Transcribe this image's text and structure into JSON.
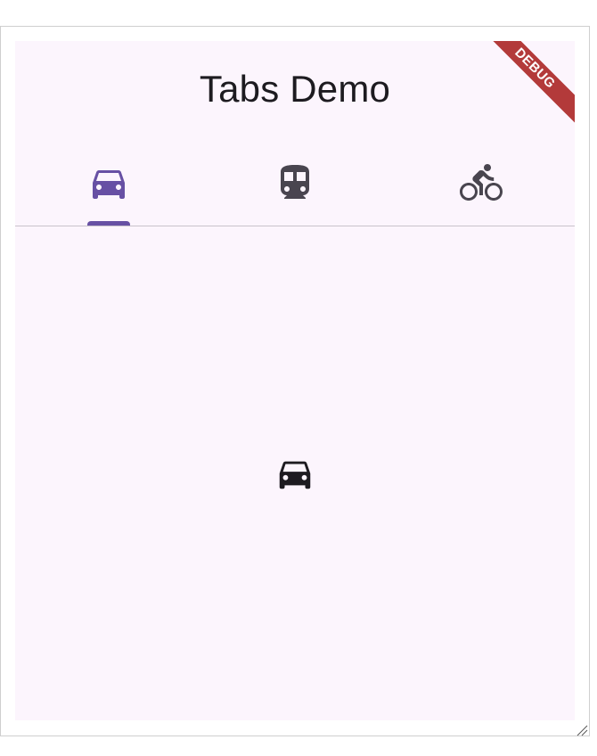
{
  "app": {
    "title": "Tabs Demo",
    "debug_banner": "DEBUG"
  },
  "tabs": [
    {
      "icon": "directions-car-icon",
      "selected": true
    },
    {
      "icon": "directions-transit-icon",
      "selected": false
    },
    {
      "icon": "directions-bike-icon",
      "selected": false
    }
  ],
  "content": {
    "icon": "directions-car-icon"
  },
  "colors": {
    "background": "#fcf5fd",
    "accent": "#6750a4",
    "icon_default": "#49454f",
    "title": "#1d1b20",
    "debug_ribbon": "#b33a3a"
  }
}
